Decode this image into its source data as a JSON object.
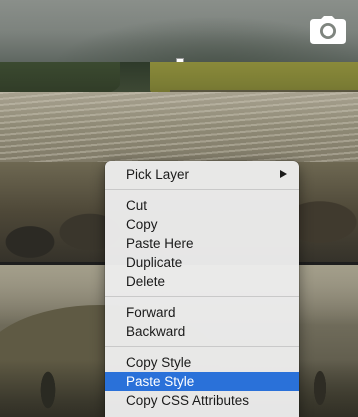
{
  "context_menu": {
    "groups": [
      [
        {
          "label": "Pick Layer",
          "submenu": true
        }
      ],
      [
        {
          "label": "Cut"
        },
        {
          "label": "Copy"
        },
        {
          "label": "Paste Here"
        },
        {
          "label": "Duplicate"
        },
        {
          "label": "Delete"
        }
      ],
      [
        {
          "label": "Forward"
        },
        {
          "label": "Backward"
        }
      ],
      [
        {
          "label": "Copy Style"
        },
        {
          "label": "Paste Style",
          "highlighted": true
        },
        {
          "label": "Copy CSS Attributes"
        }
      ]
    ]
  },
  "colors": {
    "highlight": "#2a71d9",
    "menu_background": "#ececec",
    "menu_text": "#1a1a1a"
  },
  "icons": {
    "top_right": "camera-icon",
    "pick_layer_indicator": "chevron-right-icon"
  }
}
